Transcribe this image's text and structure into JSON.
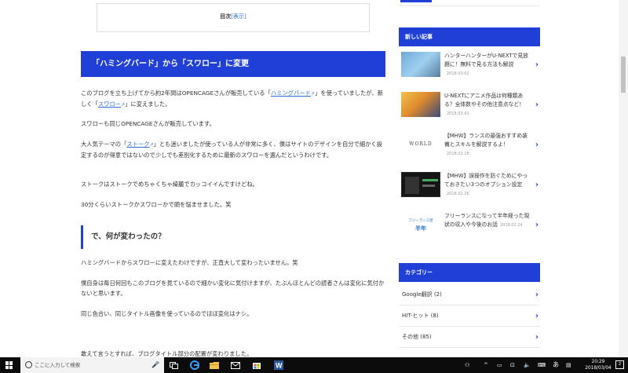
{
  "article": {
    "toc": {
      "title": "目次",
      "toggle": "[表示]"
    },
    "heading": "「ハミングバード」から「スワロー」に変更",
    "p1": {
      "a": "このブログを立ち上げてから約2年間はOPENCAGEさんが販売している「",
      "link1": "ハミングバード",
      "b": "」を使っていましたが、新しく「",
      "link2": "スワロー",
      "c": "」に変えました。"
    },
    "p2": "スワローも同じOPENCAGEさんが販売しています。",
    "p3": {
      "a": "大人気テーマの「",
      "link": "ストーク",
      "b": "」とも迷いましたが使っている人が非常に多く、僕はサイトのデザインを自分で細かく設定するのが得意ではないので少しでも差別化するために最新のスワローを選んだというわけです。"
    },
    "p4": "ストークはストークでめちゃくちゃ綺麗でカッコイイんですけどね。",
    "p5": "30分くらいストークかスワローかで頭を悩ませました。笑",
    "heading2": "で、何が変わったの？",
    "p6": "ハミングバードからスワローに変えたわけですが、正直大して変わったいません。笑",
    "p7": "僕自身は毎日何回もこのブログを見ているので細かい変化に気付けますが、たぶんほとんどの読者さんは変化に気付かないと思います。",
    "p8": "同じ色合い、同じタイトル画像を使っているのでほぼ変化はナシ。",
    "p9": "敢えて言うとすれば、ブログタイトル部分の配置が変わりました。"
  },
  "sidebar": {
    "recent_title": "新しい記事",
    "recent": [
      {
        "title": "ハンターハンターがU-NEXTで見放題に！無料で見る方法も解説",
        "date": "2018.03.02",
        "thumb_color": "#6fa8d8"
      },
      {
        "title": "U-NEXTにアニメ作品は何種類ある？全体数やその他注意点など！",
        "date": "2018.03.01",
        "thumb_color": "#e08a2e"
      },
      {
        "title": "【MHW】ランスの最強おすすめ装備とスキルを解説するよ！",
        "date": "2018.02.28",
        "thumb_text": "WORLD"
      },
      {
        "title": "【MHW】誤操作を防ぐためにやっておきたい3つのオプション設定",
        "date": "2018.02.26",
        "thumb_color": "#1a1a1a"
      },
      {
        "title": "フリーランスになって半年経った現状の収入や今後のお話",
        "date": "2018.02.24",
        "thumb_text1": "フリーランス歴",
        "thumb_text2": "半年"
      }
    ],
    "category_title": "カテゴリー",
    "categories": [
      {
        "label": "Google翻訳 (2)"
      },
      {
        "label": "HIT-ヒット (8)"
      },
      {
        "label": "その他 (85)"
      }
    ]
  },
  "taskbar": {
    "search_placeholder": "ここに入力して検索",
    "ime": "あ",
    "time": "20:29",
    "date": "2018/03/04",
    "notify": "2"
  },
  "colors": {
    "accent": "#1f3fd6",
    "link": "#2d6fd6"
  }
}
